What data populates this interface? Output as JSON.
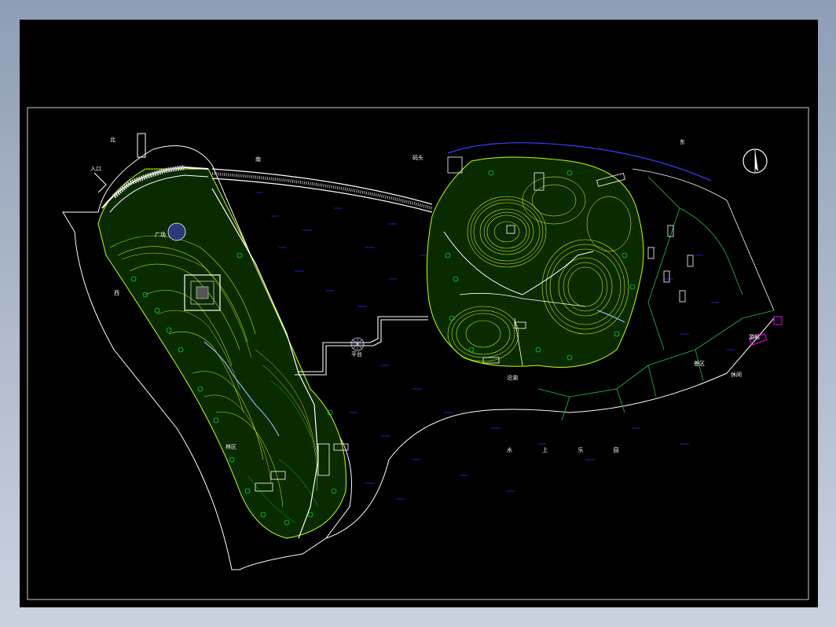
{
  "drawing": {
    "background": "#000000",
    "frame_color": "#ffffff",
    "contour_colors": [
      "#c8ff00",
      "#ffff40",
      "#7cff00",
      "#00d000"
    ],
    "water_line_color": "#1a2cff",
    "highlight_color": "#ff00ff"
  },
  "labels": {
    "west_plaza": "广场",
    "north_entry": "入口",
    "bridge_node": "平台",
    "east_shore": "沿湖",
    "south_lake": "水 上 乐 园",
    "east_zone": "景区",
    "east_zone_2": "休闲",
    "west_forest": "林区",
    "north_pier": "码头",
    "boat": "游船",
    "small_1": "北",
    "small_2": "南",
    "small_3": "西",
    "small_4": "东"
  },
  "icons": {
    "north_arrow": "north-arrow-icon",
    "compass": "compass-node-icon"
  }
}
